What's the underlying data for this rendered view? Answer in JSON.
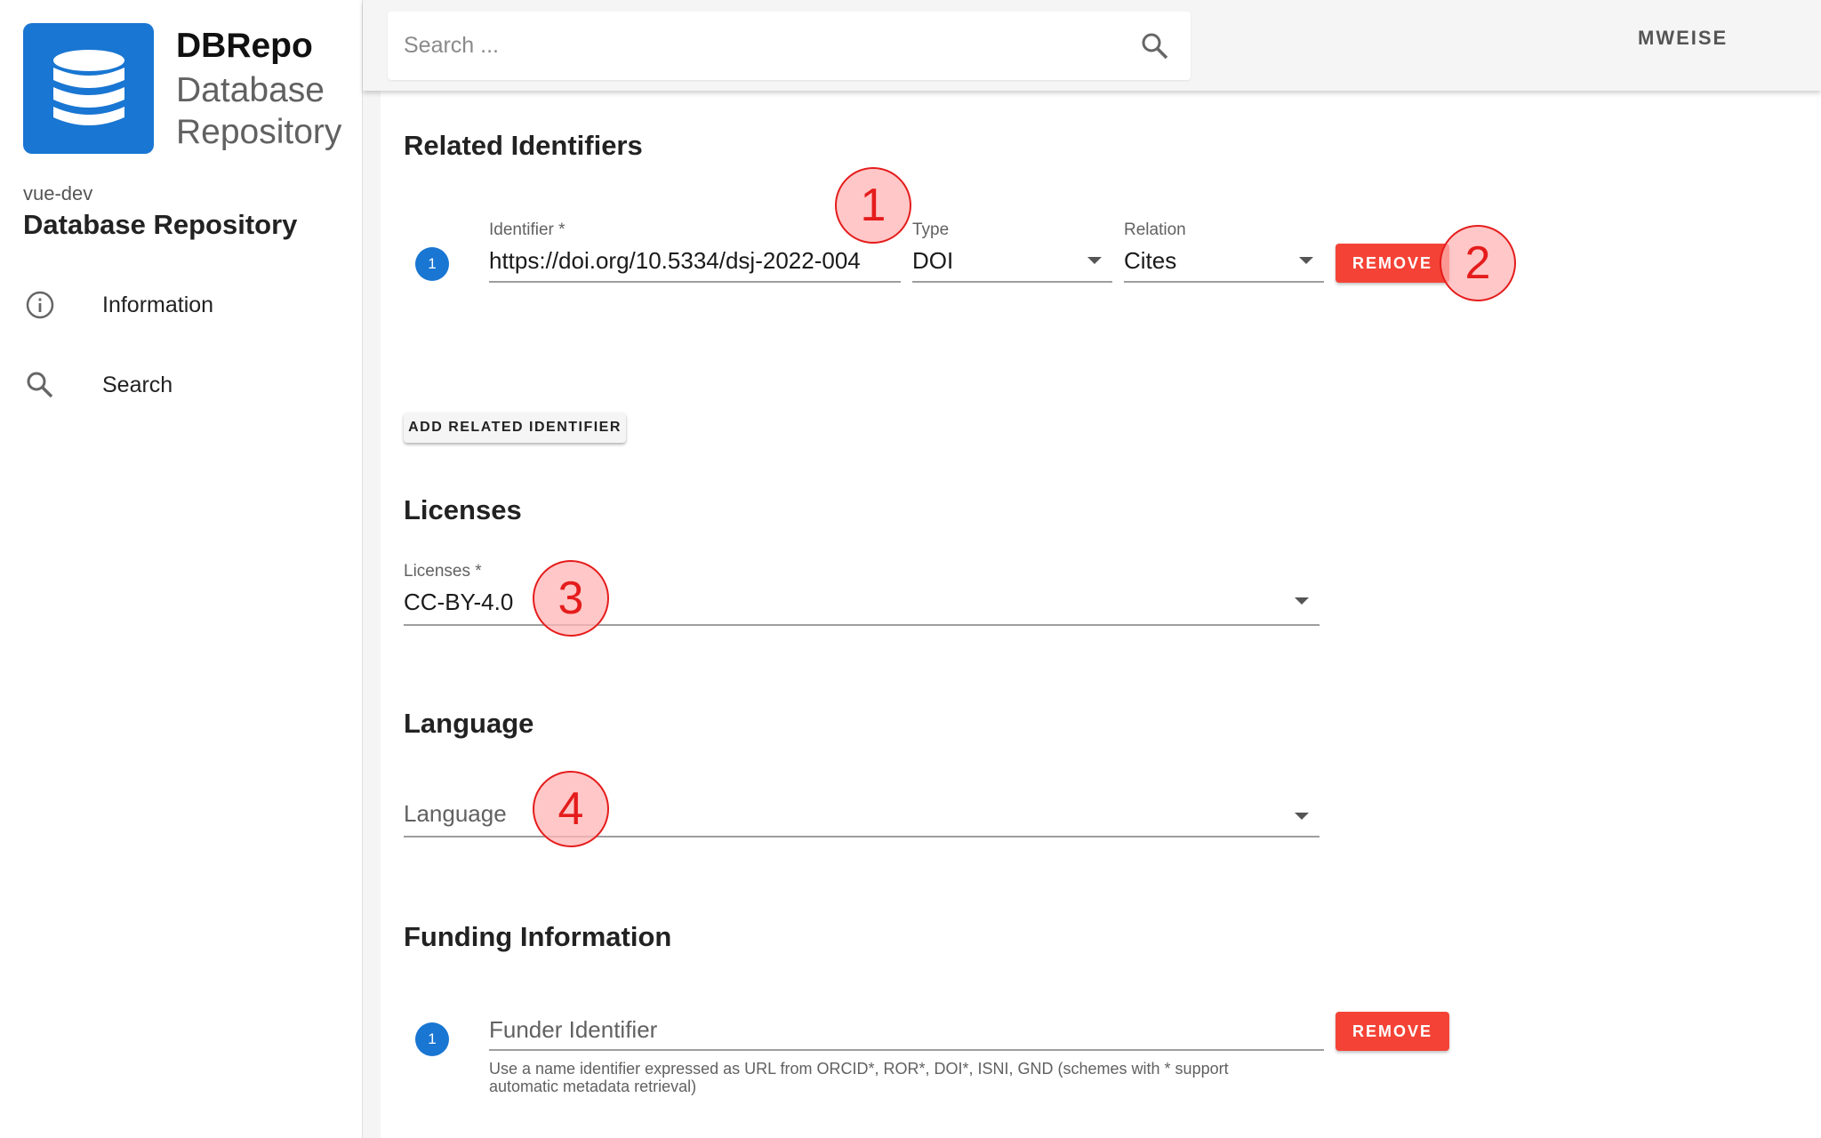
{
  "brand": {
    "title": "DBRepo",
    "subtitle": "Database Repository"
  },
  "sidebar": {
    "env": "vue-dev",
    "app_name": "Database Repository",
    "items": [
      {
        "label": "Information",
        "icon": "info-icon"
      },
      {
        "label": "Search",
        "icon": "search-icon"
      }
    ]
  },
  "topbar": {
    "search_placeholder": "Search ...",
    "user": "MWEISE"
  },
  "related": {
    "heading": "Related Identifiers",
    "index": "1",
    "identifier_label": "Identifier *",
    "identifier_value": "https://doi.org/10.5334/dsj-2022-004",
    "type_label": "Type",
    "type_value": "DOI",
    "relation_label": "Relation",
    "relation_value": "Cites",
    "remove_label": "REMOVE",
    "add_label": "ADD RELATED IDENTIFIER"
  },
  "licenses": {
    "heading": "Licenses",
    "label": "Licenses *",
    "value": "CC-BY-4.0"
  },
  "language": {
    "heading": "Language",
    "placeholder": "Language"
  },
  "funding": {
    "heading": "Funding Information",
    "index": "1",
    "placeholder": "Funder Identifier",
    "remove_label": "REMOVE",
    "hint": "Use a name identifier expressed as URL from ORCID*, ROR*, DOI*, ISNI, GND (schemes with * support automatic metadata retrieval)"
  },
  "callouts": [
    "1",
    "2",
    "3",
    "4"
  ],
  "colors": {
    "primary": "#1976d2",
    "danger": "#f44336",
    "callout": "#e51c1c"
  }
}
